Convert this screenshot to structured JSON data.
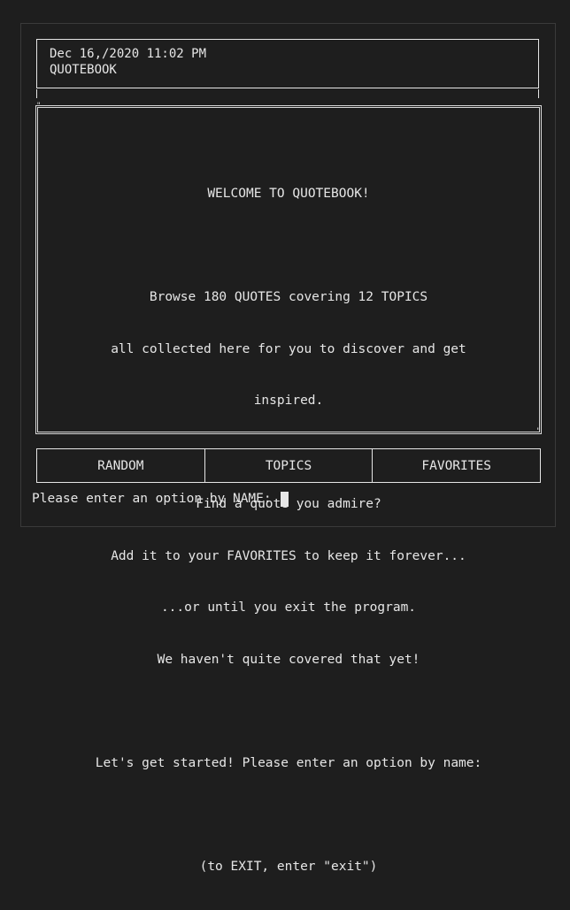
{
  "header": {
    "datetime": "Dec 16,/2020 11:02 PM",
    "app_name": "QUOTEBOOK"
  },
  "welcome": {
    "title": "WELCOME TO QUOTEBOOK!",
    "browse_line_1": "Browse 180 QUOTES covering 12 TOPICS",
    "browse_line_2": "all collected here for you to discover and get",
    "browse_line_3": "inspired.",
    "fav_line_1": "Find a quote you admire?",
    "fav_line_2": "Add it to your FAVORITES to keep it forever...",
    "fav_line_3": "...or until you exit the program.",
    "fav_line_4": "We haven't quite covered that yet!",
    "start_line": "Let's get started! Please enter an option by name:",
    "exit_line": "(to EXIT, enter \"exit\")"
  },
  "menu": {
    "items": [
      {
        "label": "RANDOM"
      },
      {
        "label": "TOPICS"
      },
      {
        "label": "FAVORITES"
      }
    ]
  },
  "prompt": {
    "text": "Please enter an option by NAME: "
  },
  "colors": {
    "background": "#1e1e1e",
    "foreground": "#e6e6e6"
  }
}
